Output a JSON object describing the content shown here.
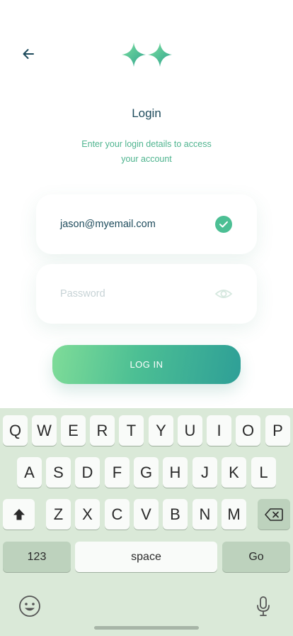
{
  "header": {
    "back_icon": "arrow-left-icon",
    "logo_icon": "sparkle-logo-icon",
    "title": "Login",
    "subtitle": "Enter your login details to access your account"
  },
  "form": {
    "email_value": "jason@myemail.com",
    "email_status_icon": "check-circle-icon",
    "password_placeholder": "Password",
    "password_toggle_icon": "eye-icon",
    "submit_label": "LOG IN"
  },
  "keyboard": {
    "row1": [
      "Q",
      "W",
      "E",
      "R",
      "T",
      "Y",
      "U",
      "I",
      "O",
      "P"
    ],
    "row2": [
      "A",
      "S",
      "D",
      "F",
      "G",
      "H",
      "J",
      "K",
      "L"
    ],
    "row3": [
      "Z",
      "X",
      "C",
      "V",
      "B",
      "N",
      "M"
    ],
    "shift_icon": "shift-icon",
    "backspace_icon": "backspace-icon",
    "numbers_label": "123",
    "space_label": "space",
    "go_label": "Go",
    "emoji_icon": "emoji-icon",
    "mic_icon": "microphone-icon"
  },
  "colors": {
    "accent": "#4cbf94",
    "title_text": "#1e4b5c",
    "keyboard_bg": "#dae9d8"
  }
}
